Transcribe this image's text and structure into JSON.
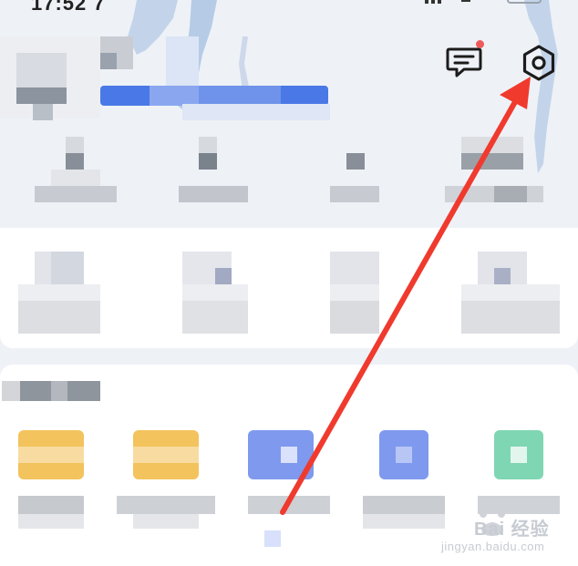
{
  "status_bar": {
    "time": "17:52 7"
  },
  "icons": {
    "message": "message-icon",
    "settings": "hexagon-settings-icon"
  },
  "colors": {
    "map_water": "#b6cbe6",
    "accent_blue": "#3f73e8",
    "badge_red": "#ee5a5a",
    "annotation_arrow": "#f03a2e",
    "tile_yellow": "#f3c35d",
    "tile_blue": "#7e99ee",
    "tile_green": "#7fd6b3"
  },
  "watermark": {
    "brand": "Bai 经验",
    "url": "jingyan.baidu.com"
  }
}
